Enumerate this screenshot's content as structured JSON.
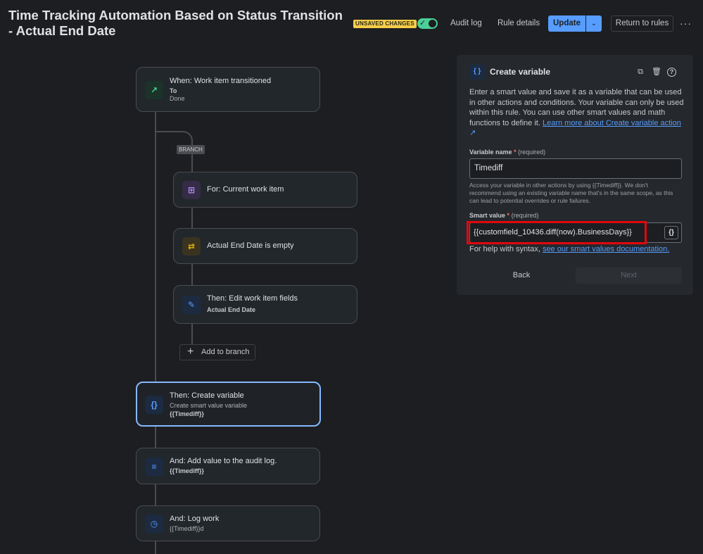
{
  "header": {
    "title": "Time Tracking Automation Based on Status Transition - Actual End Date",
    "unsaved_badge": "UNSAVED CHANGES",
    "toggle_check": "✓",
    "audit_log": "Audit log",
    "rule_details": "Rule details",
    "update": "Update",
    "update_caret": "⌄",
    "return": "Return to rules",
    "more": "···"
  },
  "flow": {
    "trigger": {
      "title": "When: Work item transitioned",
      "sub1": "To",
      "sub2": "Done",
      "icon": "↗"
    },
    "branch_tag": "BRANCH",
    "for": {
      "title": "For: Current work item",
      "icon": "⊞"
    },
    "condition": {
      "title": "Actual End Date is empty",
      "icon": "⇄"
    },
    "edit": {
      "title": "Then: Edit work item fields",
      "sub": "Actual End Date",
      "icon": "✎"
    },
    "add_branch": "Add to branch",
    "add_branch_icon": "+",
    "create_var": {
      "title": "Then: Create variable",
      "sub1": "Create smart value variable",
      "sub2": "{{Timediff}}",
      "icon": "{}"
    },
    "audit": {
      "title": "And: Add value to the audit log.",
      "sub": "{{Timediff}}",
      "icon": "≡"
    },
    "logwork": {
      "title": "And: Log work",
      "sub": "{{Timediff}}d",
      "icon": "◷"
    }
  },
  "panel": {
    "icon": "{ }",
    "title": "Create variable",
    "tools": {
      "copy": "⧉",
      "delete": "🗑",
      "help": "?"
    },
    "desc": "Enter a smart value and save it as a variable that can be used in other actions and conditions. Your variable can only be used within this rule. You can use other smart values and math functions to define it.",
    "learn_link": "Learn more about Create variable action",
    "learn_link_icon": "↗",
    "var_label": "Variable name",
    "required_mark": "*",
    "required_text": "(required)",
    "var_value": "Timediff",
    "help": "Access your variable in other actions by using {{Timediff}}. We don't recommend using an existing variable name that's in the same scope, as this can lead to potential overrides or rule failures.",
    "smart_label": "Smart value",
    "smart_value": "{{customfield_10436.diff(now).BusinessDays}}",
    "braces": "{}",
    "syntax_prefix": "For help with syntax,",
    "syntax_link": "see our smart values documentation.",
    "back": "Back",
    "next": "Next"
  },
  "colors": {
    "accent": "#579dff",
    "toggle_on": "#4bce97",
    "badge": "#f5cd47",
    "highlight": "#e0080e"
  }
}
